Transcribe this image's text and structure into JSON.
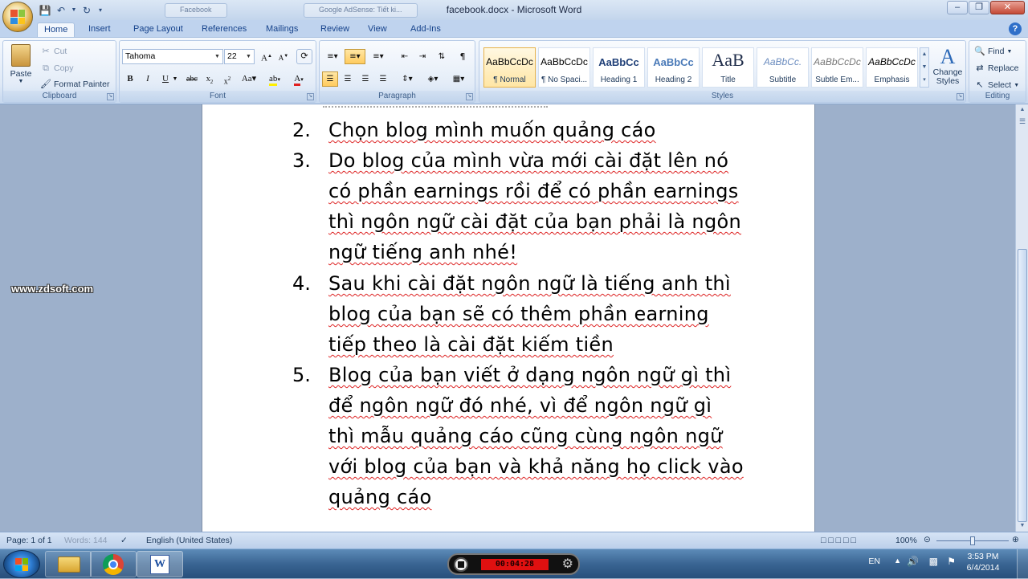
{
  "window": {
    "title": "facebook.docx - Microsoft Word",
    "bg_tab_1": "Facebook",
    "bg_tab_2": "Google AdSense: Tiết ki..."
  },
  "ribbon_tabs": [
    "Home",
    "Insert",
    "Page Layout",
    "References",
    "Mailings",
    "Review",
    "View",
    "Add-Ins"
  ],
  "clipboard": {
    "paste": "Paste",
    "cut": "Cut",
    "copy": "Copy",
    "format_painter": "Format Painter",
    "label": "Clipboard"
  },
  "font": {
    "family": "Tahoma",
    "size": "22",
    "label": "Font"
  },
  "paragraph": {
    "label": "Paragraph"
  },
  "styles": {
    "items": [
      {
        "sample": "AaBbCcDc",
        "name": "¶ Normal"
      },
      {
        "sample": "AaBbCcDc",
        "name": "¶ No Spaci..."
      },
      {
        "sample": "AaBbCc",
        "name": "Heading 1"
      },
      {
        "sample": "AaBbCc",
        "name": "Heading 2"
      },
      {
        "sample": "AaB",
        "name": "Title"
      },
      {
        "sample": "AaBbCc.",
        "name": "Subtitle"
      },
      {
        "sample": "AaBbCcDc",
        "name": "Subtle Em..."
      },
      {
        "sample": "AaBbCcDc",
        "name": "Emphasis"
      }
    ],
    "change_styles": "Change Styles",
    "label": "Styles"
  },
  "editing": {
    "find": "Find",
    "replace": "Replace",
    "select": "Select",
    "label": "Editing"
  },
  "document": {
    "items": [
      {
        "num": "2.",
        "lines": [
          "Chọn blog mình muốn quảng cáo"
        ]
      },
      {
        "num": "3.",
        "lines": [
          "Do blog của mình vừa mới cài đặt lên nó",
          "có phần earnings rồi để có phần earnings",
          "thì ngôn ngữ cài đặt của bạn phải là ngôn",
          "ngữ tiếng anh nhé!"
        ]
      },
      {
        "num": "4.",
        "lines": [
          "Sau khi cài đặt ngôn ngữ là tiếng anh thì",
          "blog của bạn sẽ có thêm phần earning",
          "tiếp theo là cài đặt kiếm tiền"
        ]
      },
      {
        "num": "5.",
        "lines": [
          "Blog của bạn viết ở dạng ngôn ngữ gì thì",
          "để ngôn ngữ đó nhé, vì để ngôn ngữ gì",
          "thì mẫu quảng cáo cũng cùng ngôn ngữ",
          "với blog của bạn và khả năng họ click vào",
          "quảng cáo"
        ]
      }
    ]
  },
  "watermark": "www.zdsoft.com",
  "statusbar": {
    "page": "Page: 1 of 1",
    "words": "Words: 144",
    "language": "English (United States)",
    "zoom": "100%"
  },
  "taskbar": {
    "recorder_time": "00:04:28",
    "lang": "EN",
    "time": "3:53 PM",
    "date": "6/4/2014"
  }
}
